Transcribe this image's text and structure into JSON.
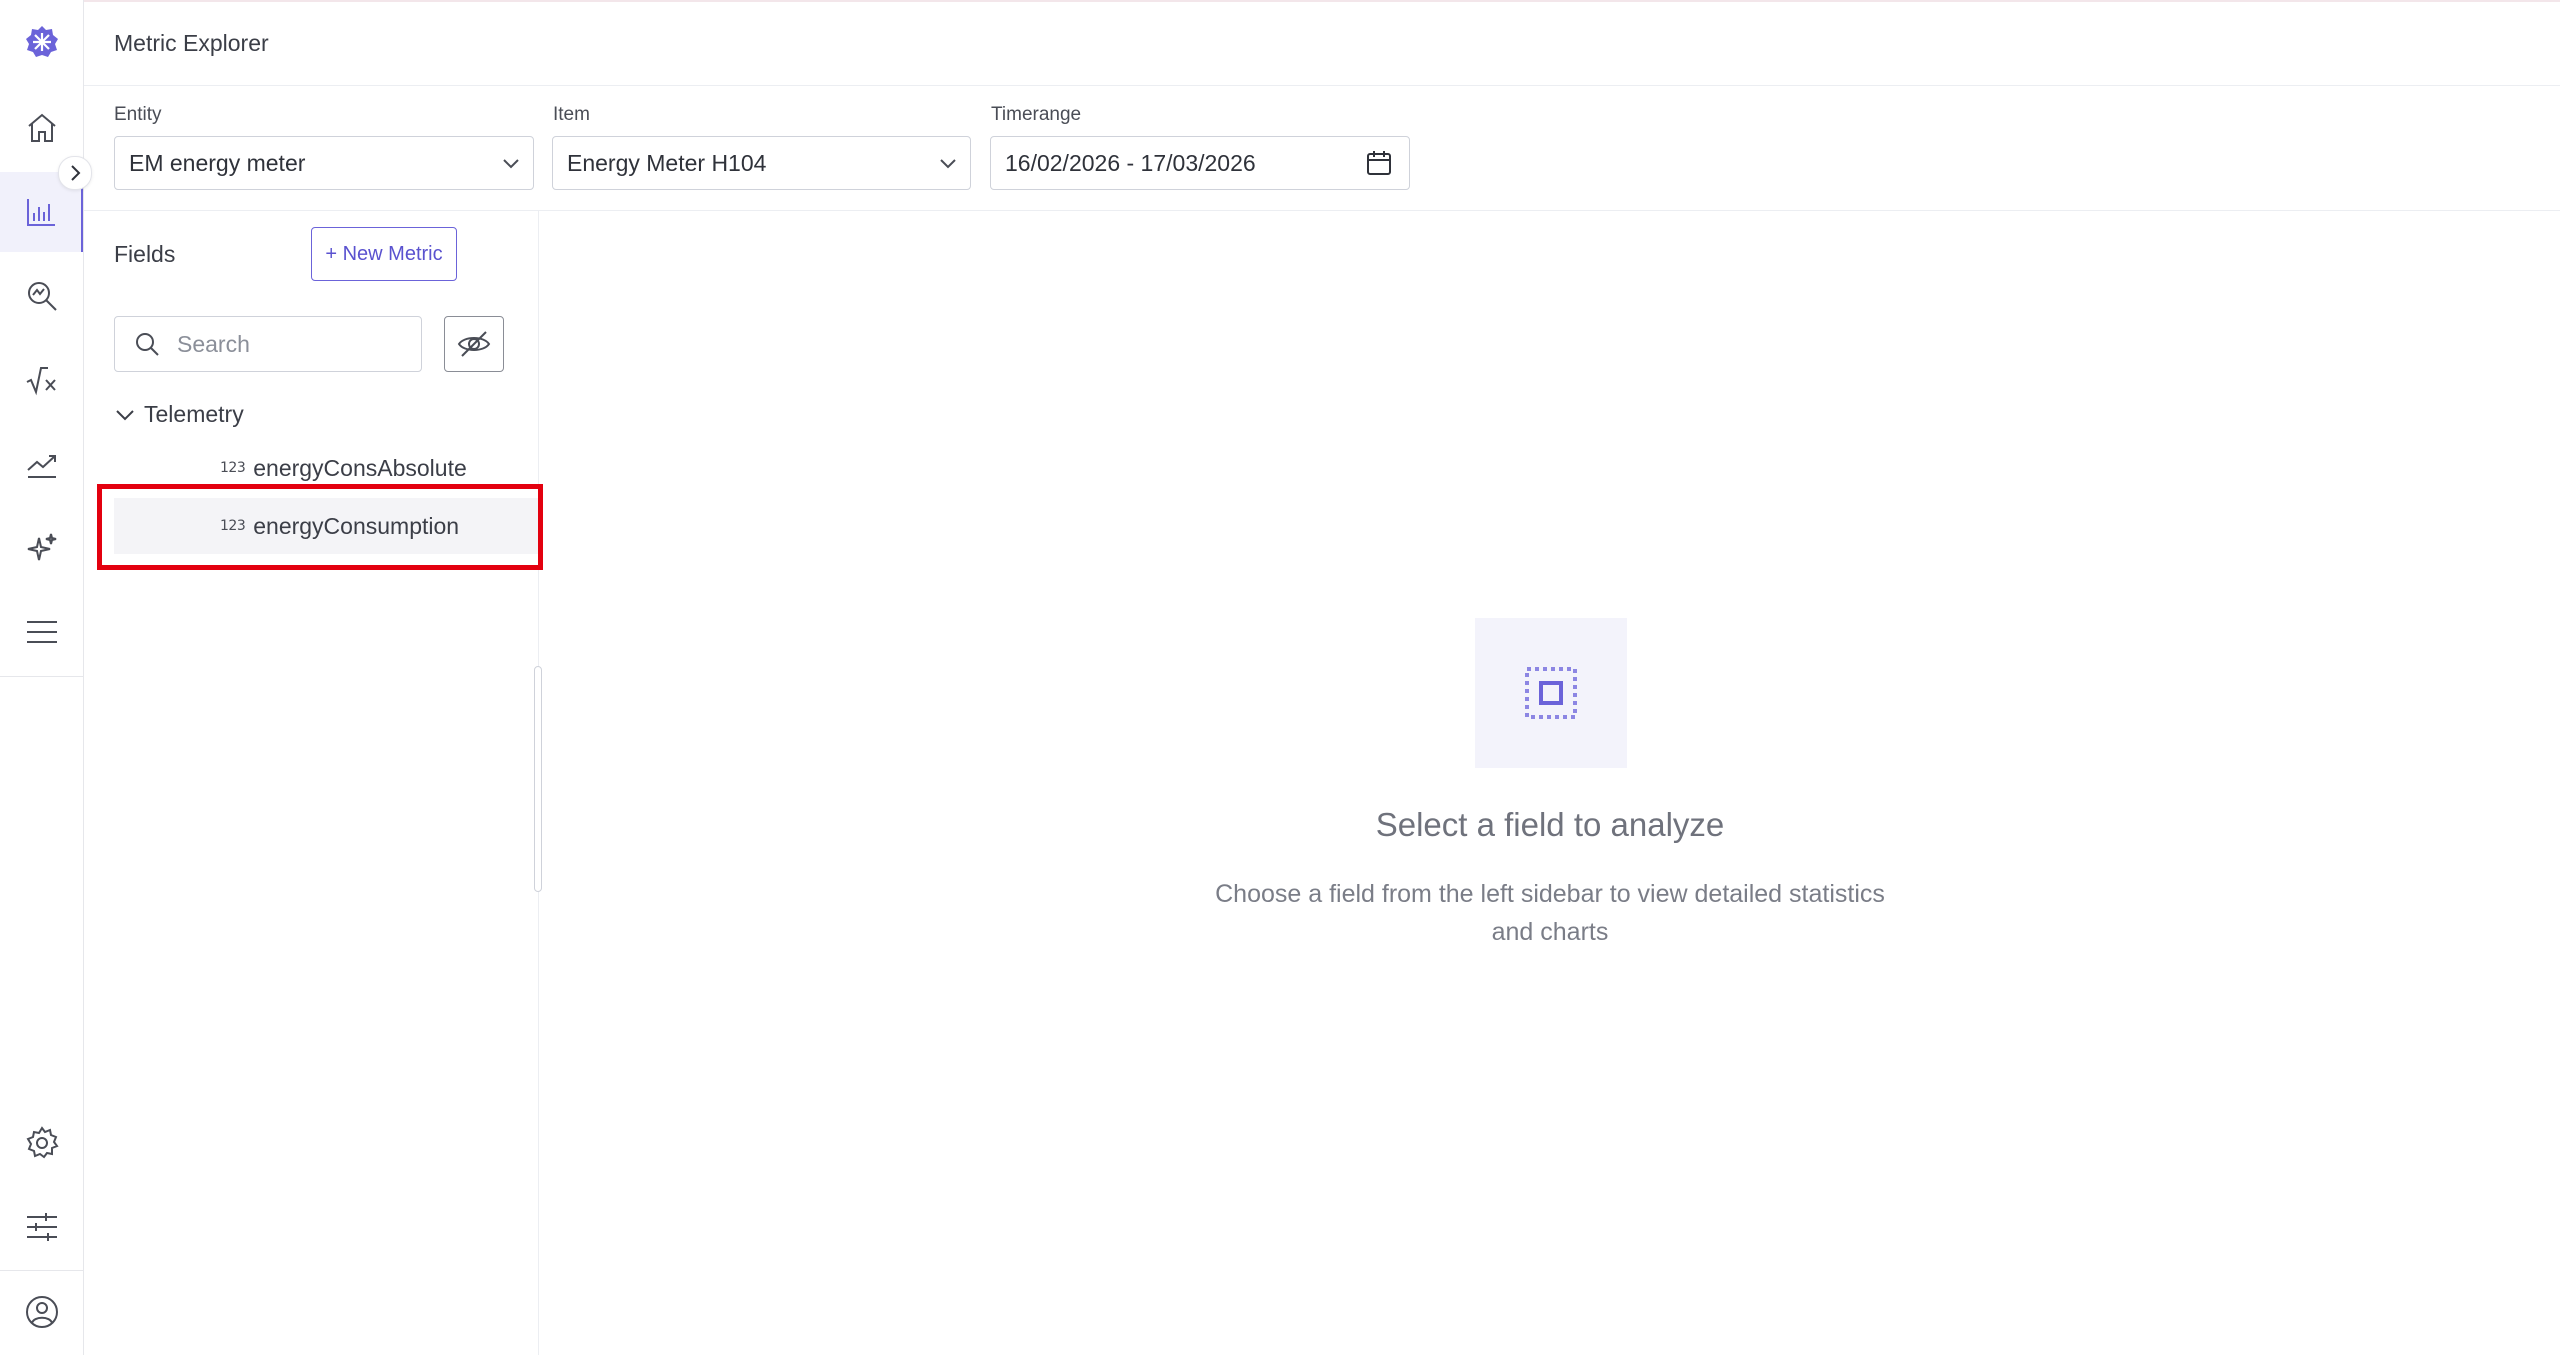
{
  "header": {
    "title": "Metric Explorer"
  },
  "filters": {
    "entity": {
      "label": "Entity",
      "value": "EM energy meter"
    },
    "item": {
      "label": "Item",
      "value": "Energy Meter H104"
    },
    "timerange": {
      "label": "Timerange",
      "value": "16/02/2026 - 17/03/2026"
    }
  },
  "fields_panel": {
    "title": "Fields",
    "new_metric_label": "+ New Metric",
    "search_placeholder": "Search",
    "group": "Telemetry",
    "field_type_icon": "123",
    "items": [
      {
        "name": "energyConsAbsolute"
      },
      {
        "name": "energyConsumption",
        "selected": true
      }
    ]
  },
  "empty_state": {
    "title": "Select a field to analyze",
    "description": "Choose a field from the left sidebar to view detailed statistics and charts"
  },
  "colors": {
    "accent": "#6b63d9",
    "highlight": "#e3000f"
  },
  "rail_icons": [
    "logo-icon",
    "home-icon",
    "bar-chart-icon",
    "search-chart-icon",
    "formula-icon",
    "trend-icon",
    "sparkle-icon",
    "menu-icon",
    "gear-icon",
    "sliders-icon",
    "user-icon"
  ]
}
